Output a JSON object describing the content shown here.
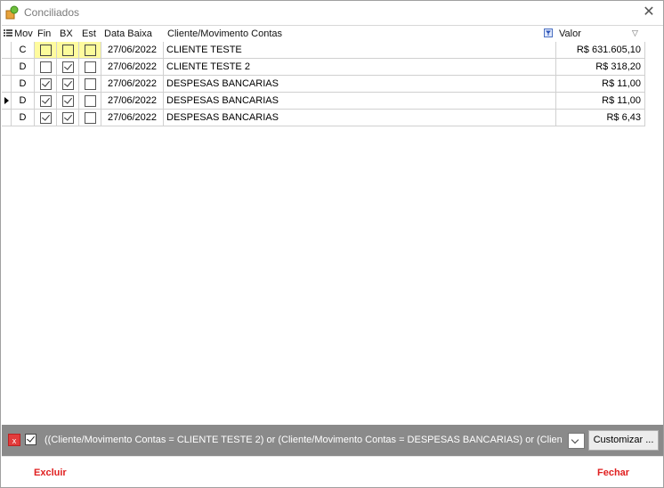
{
  "window": {
    "title": "Conciliados",
    "close_glyph": "✕"
  },
  "grid": {
    "columns": [
      "Mov",
      "Fin",
      "BX",
      "Est",
      "Data Baixa",
      "Cliente/Movimento Contas",
      "Valor"
    ],
    "rows": [
      {
        "mov": "C",
        "fin": false,
        "bx": false,
        "est": false,
        "data": "27/06/2022",
        "cliente": "CLIENTE TESTE",
        "valor": "R$ 631.605,10",
        "current": false,
        "highlight": true
      },
      {
        "mov": "D",
        "fin": false,
        "bx": true,
        "est": false,
        "data": "27/06/2022",
        "cliente": "CLIENTE TESTE 2",
        "valor": "R$ 318,20",
        "current": false,
        "highlight": false
      },
      {
        "mov": "D",
        "fin": true,
        "bx": true,
        "est": false,
        "data": "27/06/2022",
        "cliente": "DESPESAS BANCARIAS",
        "valor": "R$ 11,00",
        "current": false,
        "highlight": false
      },
      {
        "mov": "D",
        "fin": true,
        "bx": true,
        "est": false,
        "data": "27/06/2022",
        "cliente": "DESPESAS BANCARIAS",
        "valor": "R$ 11,00",
        "current": true,
        "highlight": false
      },
      {
        "mov": "D",
        "fin": true,
        "bx": true,
        "est": false,
        "data": "27/06/2022",
        "cliente": "DESPESAS BANCARIAS",
        "valor": "R$ 6,43",
        "current": false,
        "highlight": false
      }
    ]
  },
  "filterbar": {
    "clear_glyph": "x",
    "enabled": true,
    "expression": "((Cliente/Movimento Contas = CLIENTE TESTE 2) or (Cliente/Movimento Contas = DESPESAS BANCARIAS) or (Cliente/Mo",
    "customize_label": "Customizar ..."
  },
  "footer": {
    "delete_label": "Excluir",
    "close_label": "Fechar"
  },
  "colors": {
    "accent": "#e02020",
    "highlight": "#fffb9e",
    "filterbar_bg": "#8a8a8a"
  }
}
